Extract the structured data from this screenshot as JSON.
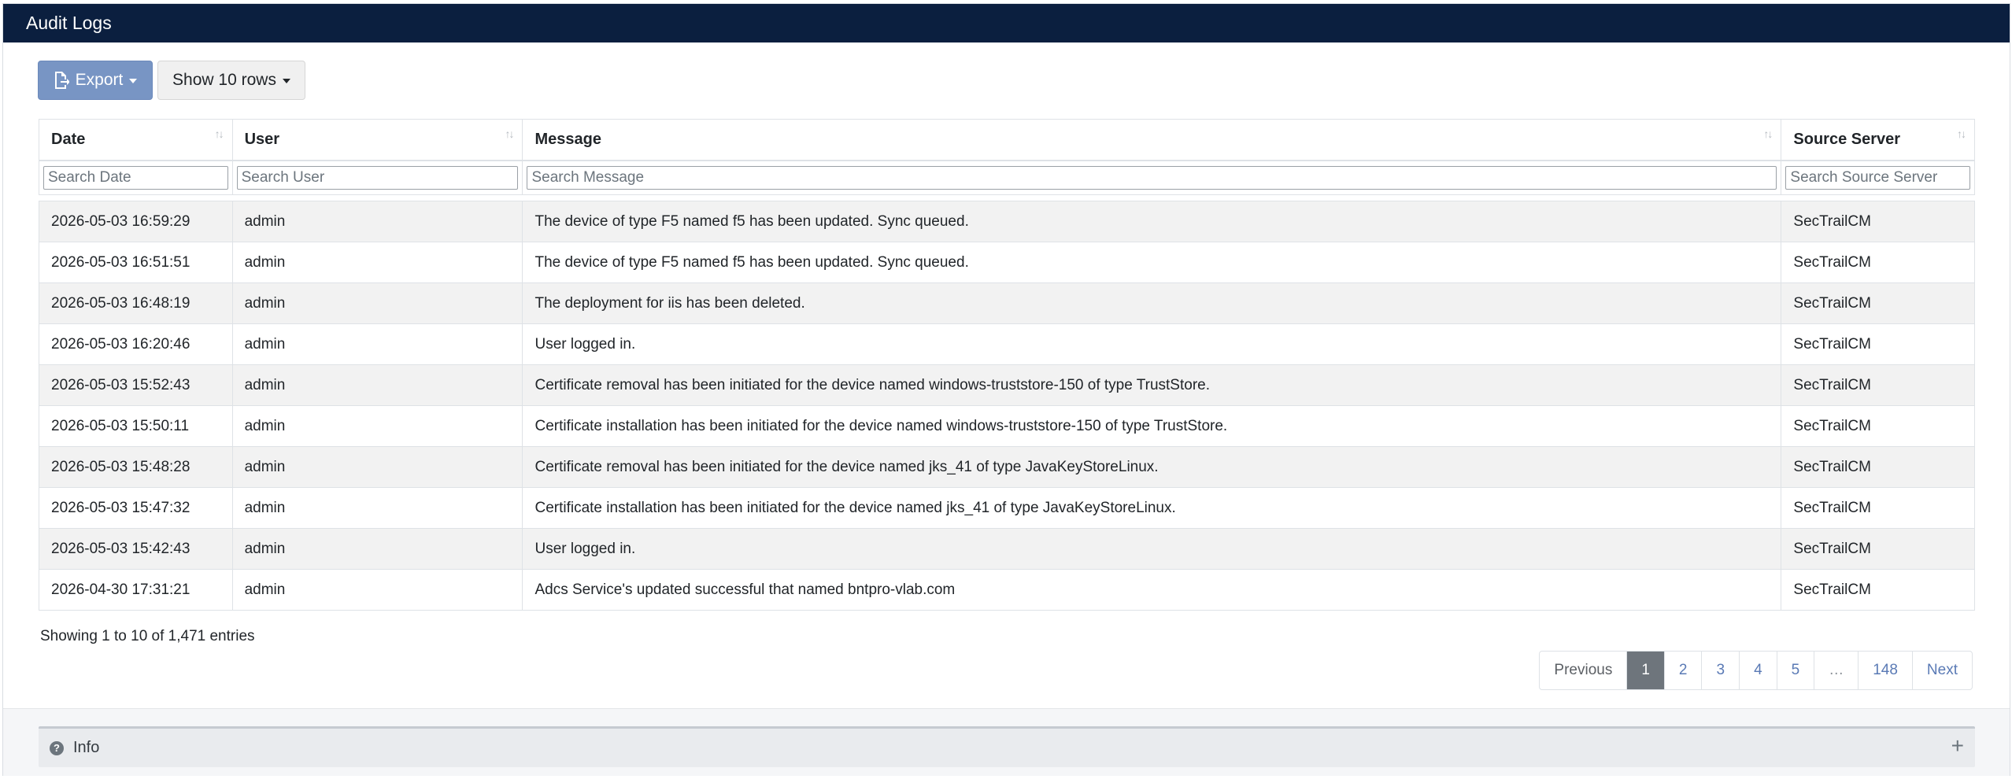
{
  "panel": {
    "title": "Audit Logs"
  },
  "toolbar": {
    "export_label": "Export",
    "rows_label": "Show 10 rows"
  },
  "columns": [
    "Date",
    "User",
    "Message",
    "Source Server"
  ],
  "filters": [
    "Search Date",
    "Search User",
    "Search Message",
    "Search Source Server"
  ],
  "rows": [
    [
      "2026-05-03 16:59:29",
      "admin",
      "The device of type F5 named f5 has been updated. Sync queued.",
      "SecTrailCM"
    ],
    [
      "2026-05-03 16:51:51",
      "admin",
      "The device of type F5 named f5 has been updated. Sync queued.",
      "SecTrailCM"
    ],
    [
      "2026-05-03 16:48:19",
      "admin",
      "The deployment for iis has been deleted.",
      "SecTrailCM"
    ],
    [
      "2026-05-03 16:20:46",
      "admin",
      "User logged in.",
      "SecTrailCM"
    ],
    [
      "2026-05-03 15:52:43",
      "admin",
      "Certificate removal has been initiated for the device named windows-truststore-150 of type TrustStore.",
      "SecTrailCM"
    ],
    [
      "2026-05-03 15:50:11",
      "admin",
      "Certificate installation has been initiated for the device named windows-truststore-150 of type TrustStore.",
      "SecTrailCM"
    ],
    [
      "2026-05-03 15:48:28",
      "admin",
      "Certificate removal has been initiated for the device named jks_41 of type JavaKeyStoreLinux.",
      "SecTrailCM"
    ],
    [
      "2026-05-03 15:47:32",
      "admin",
      "Certificate installation has been initiated for the device named jks_41 of type JavaKeyStoreLinux.",
      "SecTrailCM"
    ],
    [
      "2026-05-03 15:42:43",
      "admin",
      "User logged in.",
      "SecTrailCM"
    ],
    [
      "2026-04-30 17:31:21",
      "admin",
      "Adcs Service's updated successful that named bntpro-vlab.com",
      "SecTrailCM"
    ]
  ],
  "table_info": "Showing 1 to 10 of 1,471 entries",
  "pagination": {
    "previous": "Previous",
    "pages": [
      "1",
      "2",
      "3",
      "4",
      "5",
      "…",
      "148"
    ],
    "active_page": "1",
    "next": "Next"
  },
  "info_section": {
    "title": "Info",
    "question_icon": "question-circle-icon",
    "expand_icon": "plus-icon"
  },
  "colors": {
    "header_bg": "#0b1f3f",
    "export_btn": "#7895c4",
    "active_page": "#6e757c",
    "link": "#5a7ab5"
  }
}
